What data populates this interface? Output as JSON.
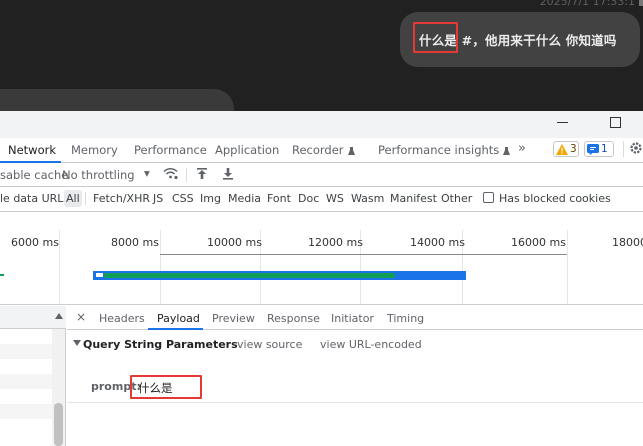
{
  "chat": {
    "timestamp": "2025/7/1 17:33:1",
    "message": "什么是 #，他用来干什么 你知道吗"
  },
  "devtools": {
    "tabs": [
      {
        "label": "Network",
        "active": true
      },
      {
        "label": "Memory"
      },
      {
        "label": "Performance"
      },
      {
        "label": "Application"
      },
      {
        "label": "Recorder"
      },
      {
        "label": "Performance insights"
      }
    ],
    "more_tabs": "»",
    "warnings_count": "3",
    "issues_count": "1",
    "toolbar": {
      "disable_cache": "sable cache",
      "throttling": "No throttling",
      "throttling_caret": "▾"
    },
    "filters": {
      "hide_data_urls": "le data URLs",
      "types": [
        "All",
        "Fetch/XHR",
        "JS",
        "CSS",
        "Img",
        "Media",
        "Font",
        "Doc",
        "WS",
        "Wasm",
        "Manifest",
        "Other"
      ],
      "selected": "All",
      "blocked_cookies": "Has blocked cookies"
    },
    "timeline": {
      "ticks": [
        "6000 ms",
        "8000 ms",
        "10000 ms",
        "12000 ms",
        "14000 ms",
        "16000 ms",
        "18000"
      ]
    },
    "details": {
      "close": "×",
      "tabs": [
        "Headers",
        "Payload",
        "Preview",
        "Response",
        "Initiator",
        "Timing"
      ],
      "active_tab": "Payload",
      "section_title": "Query String Parameters",
      "view_source": "view source",
      "view_url_encoded": "view URL-encoded",
      "param_key": "prompt:",
      "param_value": "什么是"
    }
  },
  "colors": {
    "chat_bg": "#212121",
    "bubble": "#424242",
    "accent_blue": "#1a73e8",
    "annotation_red": "#e53935",
    "bar_green": "#0f9d58"
  }
}
